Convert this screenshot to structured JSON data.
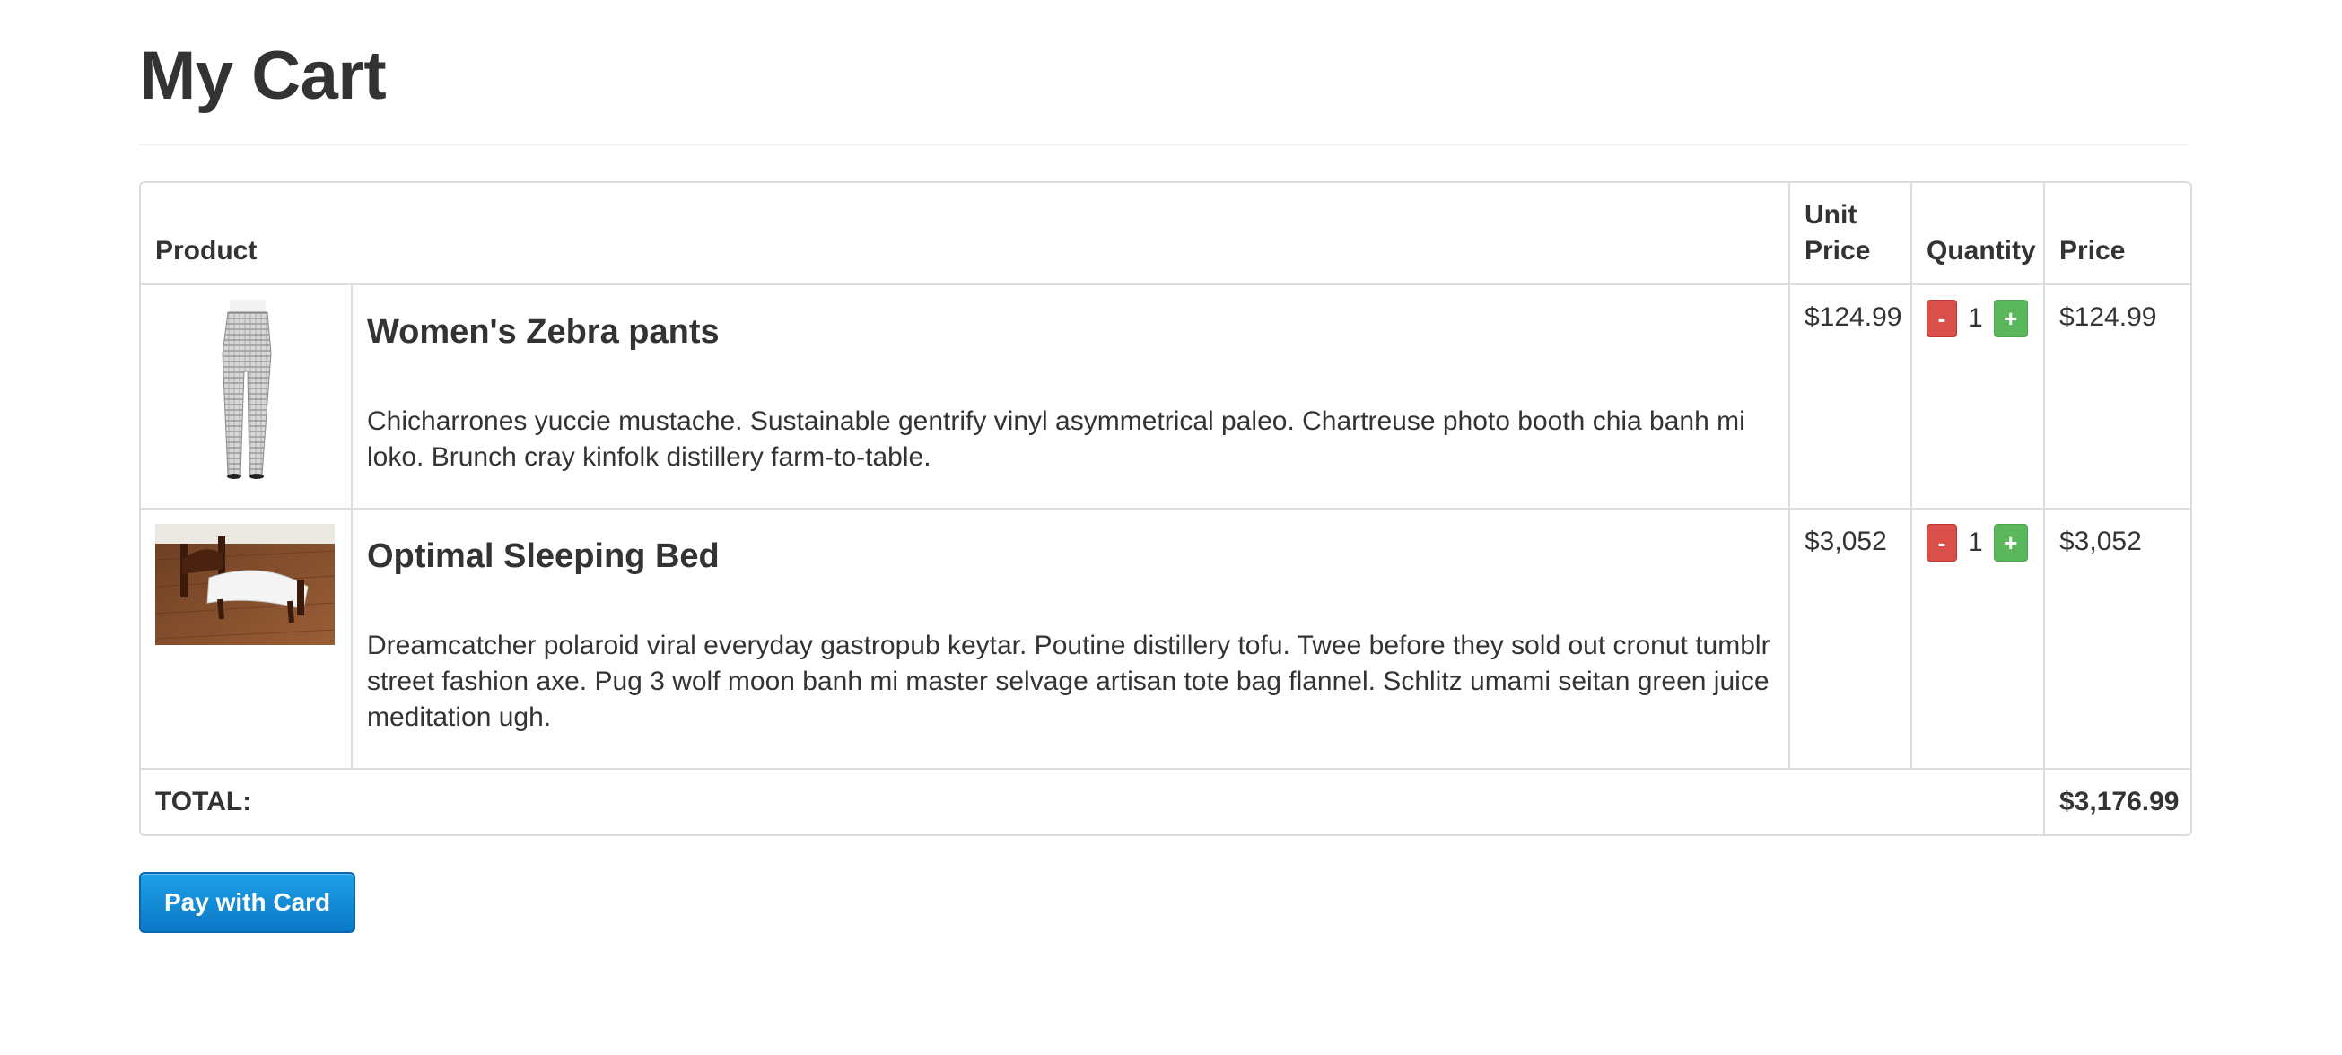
{
  "page": {
    "title": "My Cart"
  },
  "table": {
    "headers": {
      "product": "Product",
      "unit_price": "Unit Price",
      "quantity": "Quantity",
      "price": "Price"
    },
    "rows": [
      {
        "name": "Women's Zebra pants",
        "description": "Chicharrones yuccie mustache. Sustainable gentrify vinyl asymmetrical paleo. Chartreuse photo booth chia banh mi loko. Brunch cray kinfolk distillery farm-to-table.",
        "unit_price": "$124.99",
        "quantity": "1",
        "price": "$124.99",
        "image_icon": "pants-image"
      },
      {
        "name": "Optimal Sleeping Bed",
        "description": "Dreamcatcher polaroid viral everyday gastropub keytar. Poutine distillery tofu. Twee before they sold out cronut tumblr street fashion axe. Pug 3 wolf moon banh mi master selvage artisan tote bag flannel. Schlitz umami seitan green juice meditation ugh.",
        "unit_price": "$3,052",
        "quantity": "1",
        "price": "$3,052",
        "image_icon": "bed-image"
      }
    ],
    "total_label": "TOTAL:",
    "total_value": "$3,176.99"
  },
  "controls": {
    "minus_label": "-",
    "plus_label": "+"
  },
  "checkout": {
    "pay_label": "Pay with Card"
  },
  "colors": {
    "minus": "#da4f49",
    "plus": "#5bb75b",
    "pay": "#1a8fd8",
    "border": "#dddddd",
    "text": "#333333"
  }
}
